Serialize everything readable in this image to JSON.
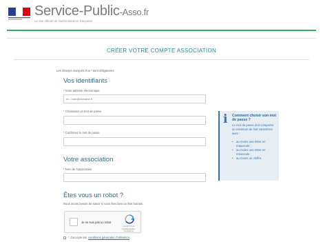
{
  "header": {
    "site_title": "Service-Public",
    "site_title_suffix": "-Asso",
    "site_title_tld": ".fr",
    "subtitle": "Le site officiel de l'administration française",
    "logo": "marianne-flag-logo"
  },
  "form": {
    "title": "CRÉER VOTRE COMPTE ASSOCIATION",
    "required_note": "Les champs marqués d'un * sont obligatoires",
    "identifiants": {
      "heading": "Vos identifiants",
      "email_label": "Votre adresse électronique",
      "email_placeholder": "ex : nom@domaine.fr",
      "password_label": "Choisissez un mot de passe",
      "password_confirm_label": "Confirmez le mot de passe"
    },
    "association": {
      "heading": "Votre association",
      "name_label": "Nom de l'association"
    },
    "robot": {
      "heading": "Êtes vous un robot ?",
      "text": "Nous avons besoin de savoir si vous êtes bien un être humain.",
      "captcha_label": "Je ne suis pas un robot",
      "captcha_brand": "reCAPTCHA",
      "captcha_links": "Confidentialité - Conditions"
    },
    "terms": {
      "prefix": "* J'accepte les",
      "link": "conditions générales d'utilisation"
    }
  },
  "help": {
    "icon": "info-icon",
    "title": "Comment choisir son mot de passe ?",
    "text": "Le mot de passe doit comporter un minimum de huit caractères avec :",
    "items": [
      "au moins une lettre en majuscule ;",
      "au moins une lettre en minuscule ;",
      "au moins un chiffre."
    ]
  },
  "colors": {
    "accent_green": "#3aa76d",
    "title_teal": "#2a8c97",
    "heading_blue": "#2a6f8c",
    "help_blue": "#3a6ea8"
  }
}
